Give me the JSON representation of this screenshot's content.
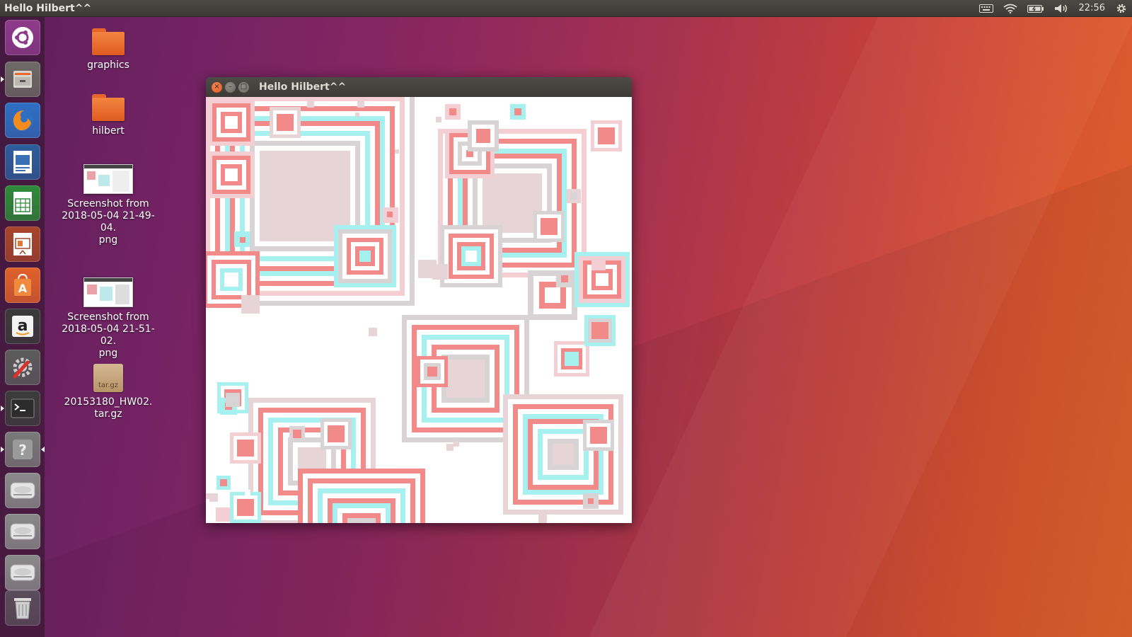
{
  "top_panel": {
    "title": "Hello Hilbert^^",
    "clock": "22:56",
    "indicators": [
      "keyboard-icon",
      "wifi-icon",
      "battery-icon",
      "volume-icon",
      "gear-icon"
    ]
  },
  "launcher": {
    "items": [
      {
        "name": "ubuntu-dash",
        "icon": "ubuntu-logo-icon",
        "color": "#8e3a8c"
      },
      {
        "name": "files",
        "icon": "file-cabinet-icon",
        "color": "#6e6a66"
      },
      {
        "name": "firefox",
        "icon": "firefox-icon",
        "color": "#2e6fc4"
      },
      {
        "name": "libreoffice-writer",
        "icon": "writer-icon",
        "color": "#2d5d9c"
      },
      {
        "name": "libreoffice-calc",
        "icon": "calc-icon",
        "color": "#2f8a3a"
      },
      {
        "name": "libreoffice-impress",
        "icon": "impress-icon",
        "color": "#a8452b"
      },
      {
        "name": "software-center",
        "icon": "shopping-bag-icon",
        "color": "#e0612a"
      },
      {
        "name": "amazon",
        "icon": "amazon-icon",
        "color": "#3a3a3a"
      },
      {
        "name": "system-settings",
        "icon": "wrench-gear-icon",
        "color": "#5c5c5c"
      },
      {
        "name": "terminal",
        "icon": "terminal-icon",
        "color": "#3c3c3c"
      },
      {
        "name": "help",
        "icon": "question-icon",
        "color": "#7a7a7a"
      },
      {
        "name": "drive-1",
        "icon": "drive-icon",
        "color": "#8a8a8a"
      },
      {
        "name": "drive-2",
        "icon": "drive-icon",
        "color": "#8a8a8a"
      },
      {
        "name": "drive-3",
        "icon": "drive-icon",
        "color": "#8a8a8a"
      },
      {
        "name": "trash",
        "icon": "trash-icon",
        "color": "#5a4c5a"
      }
    ]
  },
  "desktop": {
    "icons": [
      {
        "label": "graphics",
        "type": "folder"
      },
      {
        "label": "hilbert",
        "type": "folder"
      },
      {
        "label": "Screenshot from\n2018-05-04 21-49-04.\npng",
        "type": "image"
      },
      {
        "label": "Screenshot from\n2018-05-04 21-51-02.\npng",
        "type": "image"
      },
      {
        "label": "20153180_HW02.\ntar.gz",
        "type": "archive",
        "badge": "tar.gz"
      }
    ]
  },
  "window": {
    "title": "Hello Hilbert^^",
    "close_glyph": "×",
    "min_glyph": "–",
    "max_glyph": "□"
  },
  "colors": {
    "red": "#f28a8a",
    "cyan": "#a6f0ef",
    "grey": "#d8d4d6",
    "pink": "#f3cfd4",
    "dusty": "#e6d4d6"
  }
}
